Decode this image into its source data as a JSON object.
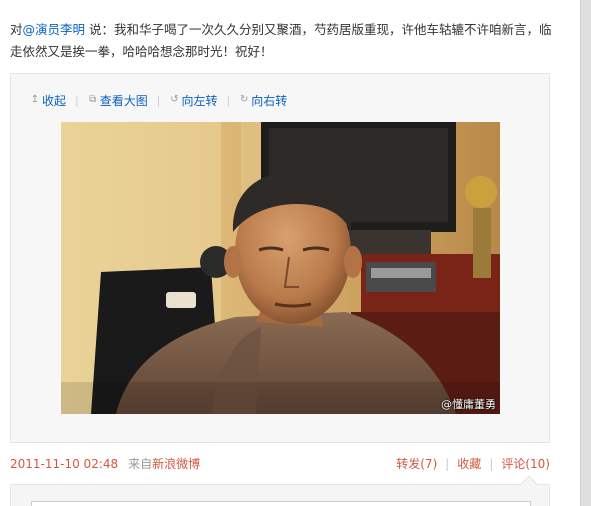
{
  "post": {
    "prefix": "对",
    "mention": "@演员李明",
    "text": " 说：我和华子喝了一次久久分别又聚酒，芍药居版重现，许他车轱辘不许咱新言，临走依然又是挨一拳，哈哈哈想念那时光！祝好！"
  },
  "toolbar": {
    "collapse": {
      "label": "收起",
      "icon": "arrow-up-icon"
    },
    "view_large": {
      "label": "查看大图",
      "icon": "external-link-icon"
    },
    "rotate_left": {
      "label": "向左转",
      "icon": "rotate-left-icon"
    },
    "rotate_right": {
      "label": "向右转",
      "icon": "rotate-right-icon"
    }
  },
  "photo": {
    "watermark": "@懂庸董勇"
  },
  "meta": {
    "timestamp": "2011-11-10 02:48",
    "from_label": "来自",
    "source": "新浪微博"
  },
  "actions": {
    "repost": "转发(7)",
    "favorite": "收藏",
    "comment": "评论(10)"
  },
  "colors": {
    "link_blue": "#0a61c3",
    "accent_orange": "#d8573d"
  }
}
